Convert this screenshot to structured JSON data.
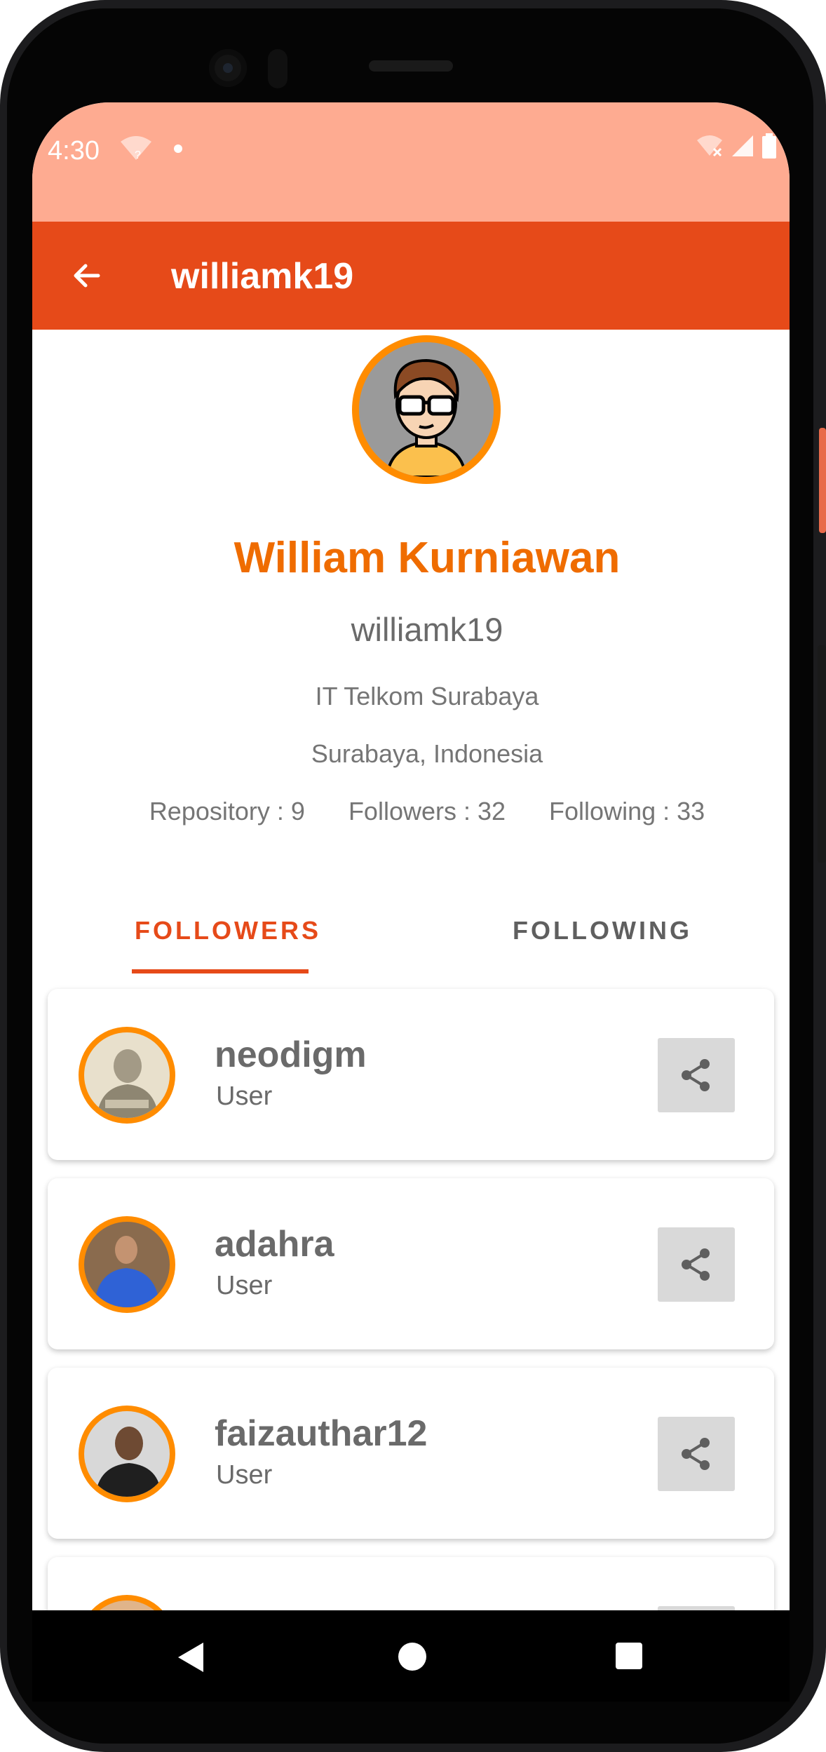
{
  "status_bar": {
    "time": "4:30"
  },
  "app_bar": {
    "title": "williamk19",
    "back_icon": "arrow-left-icon"
  },
  "profile": {
    "name": "William Kurniawan",
    "login": "williamk19",
    "company": "IT Telkom Surabaya",
    "location": "Surabaya, Indonesia",
    "repository": "Repository : 9",
    "followers": "Followers : 32",
    "following": "Following : 33"
  },
  "tabs": [
    {
      "label": "FOLLOWERS",
      "selected": true
    },
    {
      "label": "FOLLOWING",
      "selected": false
    }
  ],
  "users": [
    {
      "login": "neodigm",
      "type": "User"
    },
    {
      "login": "adahra",
      "type": "User"
    },
    {
      "login": "faizauthar12",
      "type": "User"
    }
  ],
  "colors": {
    "status_bar": "#feab91",
    "app_bar": "#e64a19",
    "accent": "#ef6c00",
    "avatar_ring": "#ff8c00"
  },
  "icons": {
    "share": "share-icon",
    "nav_back": "nav-back-icon",
    "nav_home": "nav-home-icon",
    "nav_recents": "nav-recents-icon"
  }
}
